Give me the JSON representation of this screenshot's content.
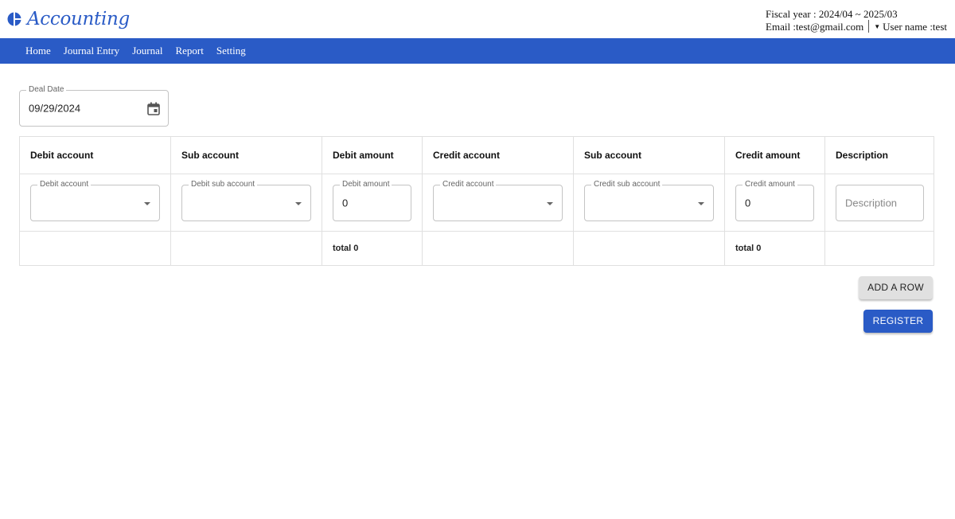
{
  "app": {
    "title": "Accounting",
    "brand_color": "#2a5bc6"
  },
  "user": {
    "fiscal_year": "Fiscal year : 2024/04 ~ 2025/03",
    "email": "Email :test@gmail.com",
    "username": "User name :test"
  },
  "nav": {
    "items": [
      {
        "label": "Home"
      },
      {
        "label": "Journal Entry"
      },
      {
        "label": "Journal"
      },
      {
        "label": "Report"
      },
      {
        "label": "Setting"
      }
    ]
  },
  "deal_date": {
    "label": "Deal Date",
    "value": "09/29/2024",
    "icon": "calendar-icon"
  },
  "table": {
    "headers": [
      "Debit account",
      "Sub account",
      "Debit amount",
      "Credit account",
      "Sub account",
      "Credit amount",
      "Description"
    ],
    "row": {
      "debit_account": {
        "label": "Debit account",
        "value": ""
      },
      "debit_sub_account": {
        "label": "Debit sub account",
        "value": ""
      },
      "debit_amount": {
        "label": "Debit amount",
        "value": "0"
      },
      "credit_account": {
        "label": "Credit account",
        "value": ""
      },
      "credit_sub_account": {
        "label": "Credit sub account",
        "value": ""
      },
      "credit_amount": {
        "label": "Credit amount",
        "value": "0"
      },
      "description": {
        "placeholder": "Description",
        "value": ""
      }
    },
    "totals": {
      "debit": "total 0",
      "credit": "total 0"
    }
  },
  "actions": {
    "add_row": "ADD A ROW",
    "register": "REGISTER"
  }
}
